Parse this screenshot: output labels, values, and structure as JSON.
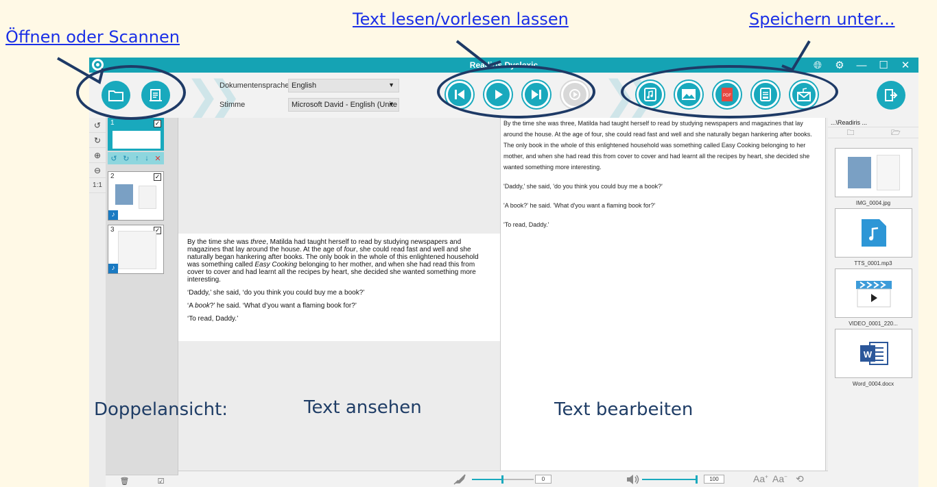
{
  "annotations": {
    "open_link": "Öffnen oder Scannen",
    "read_link": "Text lesen/vorlesen lassen",
    "save_link": "Speichern unter...",
    "label_view_mode": "Doppelansicht:",
    "label_view_text": "Text ansehen",
    "label_edit_text": "Text bearbeiten"
  },
  "window": {
    "title": "Readiris Dyslexic",
    "accent": "#15a3b4"
  },
  "toolbar": {
    "doc_lang_label": "Dokumentensprache",
    "doc_lang_value": "English",
    "voice_label": "Stimme",
    "voice_value": "Microsoft David - English (Unite"
  },
  "tools": [
    "↺",
    "↻",
    "⊕",
    "⊖",
    "1:1"
  ],
  "thumbnails": [
    {
      "num": "1",
      "checked": "✓"
    },
    {
      "num": "2",
      "checked": "✓"
    },
    {
      "num": "3",
      "checked": "✓"
    }
  ],
  "view_text": {
    "p1_a": "By the time she was ",
    "p1_em": "three",
    "p1_b": ", Matilda had taught herself to read by studying newspapers and magazines that lay around the house. At the age of ",
    "p1_em2": "four",
    "p1_c": ", she could read fast and well and she naturally began hankering after books. The only book in the whole of this enlightened household was something called ",
    "p1_em3": "Easy Cooking",
    "p1_d": " belonging to her mother, and when she had read this from cover to cover and had learnt all the recipes by heart, she decided she wanted something more interesting.",
    "p2": "‘Daddy,’ she said, ‘do you think you could buy me a book?’",
    "p3_a": "‘A ",
    "p3_em": "book",
    "p3_b": "?’ he said. ‘What d’you want a flaming book for?’",
    "p4": "‘To read, Daddy.’"
  },
  "edit_text": {
    "p1": "By the time she was three, Matilda had taught herself to read by studying newspapers and magazines that lay around the house. At the age of four, she could read fast and well and she naturally began hankering after books. The only book in the whole of this enlightened household was something called Easy Cooking belonging to her mother, and when she had read this from cover to cover and had learnt all the recipes by heart, she decided she wanted something more interesting.",
    "p2": "'Daddy,' she said, 'do you think you could buy me a book?'",
    "p3": "'A book?' he said. 'What d'you want a flaming book for?'",
    "p4": "'To read, Daddy.'"
  },
  "files": {
    "path": "...\\Readiris ...",
    "items": [
      {
        "name": "IMG_0004.jpg",
        "icon": "image-thumbnail"
      },
      {
        "name": "TTS_0001.mp3",
        "icon": "music-file-icon"
      },
      {
        "name": "VIDEO_0001_220...",
        "icon": "video-file-icon"
      },
      {
        "name": "Word_0004.docx",
        "icon": "word-file-icon"
      }
    ]
  },
  "status": {
    "speed_value": "0",
    "speed_level": 0.5,
    "volume_value": "100",
    "volume_level": 1.0,
    "font_larger": "Aa",
    "font_smaller": "Aa"
  }
}
